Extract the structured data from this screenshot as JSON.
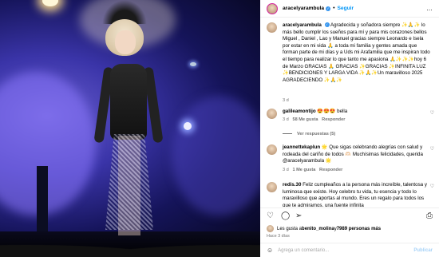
{
  "post": {
    "author": "aracelyarambula",
    "follow_label": "Seguir",
    "dot": "•",
    "more_icon": "…"
  },
  "caption": {
    "username": "aracelyarambula",
    "text": "Agradecida y soñadora siempre ✨🙏✨ lo más bello cumplir los sueños para mí y para mis corazones bellos Miguel , Daniel , Lao y Manuel gracias siempre Leonardo e Isela por estar en mi vida 🙏 a toda mi familia y gentes amada que forman parte de mi días y a Uds mi Arafamilia que me inspiran todo el tiempo para realizar lo que tanto me apasiona 🙏✨✨✨hoy 6 de Marzo GRACIAS 🙏 GRACIAS ✨GRACIAS ✨INFINITA LUZ ✨BENDICIONES Y LARGA VIDA ✨🙏✨Un maravilloso 2025 AGRADECIENDO ✨🙏✨",
    "time": "3 d"
  },
  "comments": [
    {
      "username": "galileamontijo",
      "text": "😍😍😍 bella",
      "time": "3 d",
      "likes": "58 Me gusta",
      "reply": "Responder",
      "replies": "Ver respuestas (5)"
    },
    {
      "username": "jeannettekaplun",
      "text": "🌟 Que sigas celebrando alegrías con salud y rodeada del cariño de todos 🫶🏻 Muchísimas felicidades, querida @aracelyarambula 🌟",
      "time": "3 d",
      "likes": "1 Me gusta",
      "reply": "Responder"
    },
    {
      "username": "redis.30",
      "text": "Feliz cumpleaños a la persona más increíble, talentosa y luminosa que existe. Hoy celebro tu vida, tu esencia y todo lo maravilloso que aportas al mundo. Eres un regalo para todos los que te admiramos, una fuente infinita"
    }
  ],
  "actions": {
    "like_icon": "♡",
    "comment_icon": "◯",
    "share_icon": "➢",
    "save_icon": "⎙"
  },
  "likes": {
    "prefix": "Les gusta a ",
    "user": "benito_molina",
    "middle": " y ",
    "count": "7989 personas más"
  },
  "posted": "Hace 3 días",
  "add_comment": {
    "emoji_icon": "☺",
    "placeholder": "Agrega un comentario...",
    "publish_label": "Publicar"
  },
  "colors": {
    "accent": "#0095f6",
    "verified": "#3897f0",
    "meta": "#737373"
  }
}
